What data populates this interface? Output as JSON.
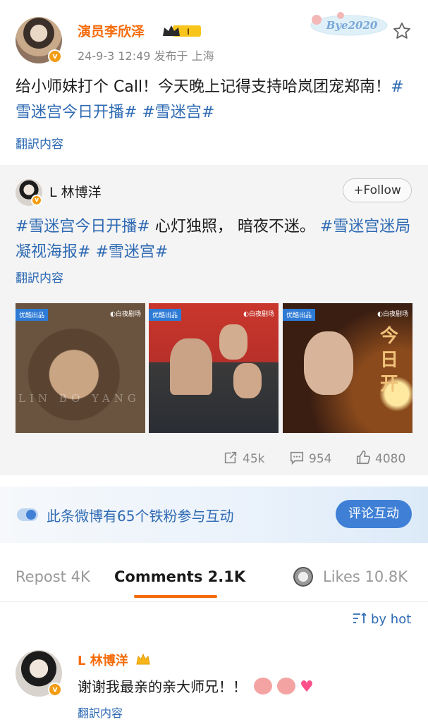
{
  "post": {
    "author": "演员李欣泽",
    "level_badge": "I",
    "meta": "24-9-3 12:49  发布于 上海",
    "sticker_text": "Bye2020",
    "text_plain": "给小师妹打个 Call！今天晚上记得支持哈岚团宠郑南！",
    "tag1": "#雪迷宫今日开播#",
    "tag2": "#雪迷宫#",
    "translate": "翻訳内容"
  },
  "repost": {
    "author": "L 林博洋",
    "follow": "+Follow",
    "tag1": "#雪迷宫今日开播#",
    "text_plain": " 心灯独照， 暗夜不迷。",
    "tag2": "#雪迷宫迷局凝视海报#",
    "tag3": "#雪迷宫#",
    "translate": "翻訳内容",
    "images": [
      {
        "tag": "优酷出品",
        "brand": "◐白夜剧场",
        "caption": "LIN BO YANG"
      },
      {
        "tag": "优酷出品",
        "brand": "◐白夜剧场"
      },
      {
        "tag": "优酷出品",
        "brand": "◐白夜剧场",
        "caption": "今日开"
      }
    ],
    "stats": {
      "reposts": "45k",
      "comments": "954",
      "likes": "4080"
    }
  },
  "fan_banner": {
    "text": "此条微博有65个铁粉参与互动",
    "button": "评论互动"
  },
  "tabs": {
    "repost": "Repost 4K",
    "comments": "Comments 2.1K",
    "likes": "Likes 10.8K"
  },
  "sort": "by hot",
  "comment": {
    "author": "L 林博洋",
    "text": "谢谢我最亲的亲大师兄！！",
    "translate": "翻訳内容"
  },
  "colors": {
    "accent": "#f56b0a",
    "link": "#2e6ab3",
    "button": "#3f80d6"
  }
}
